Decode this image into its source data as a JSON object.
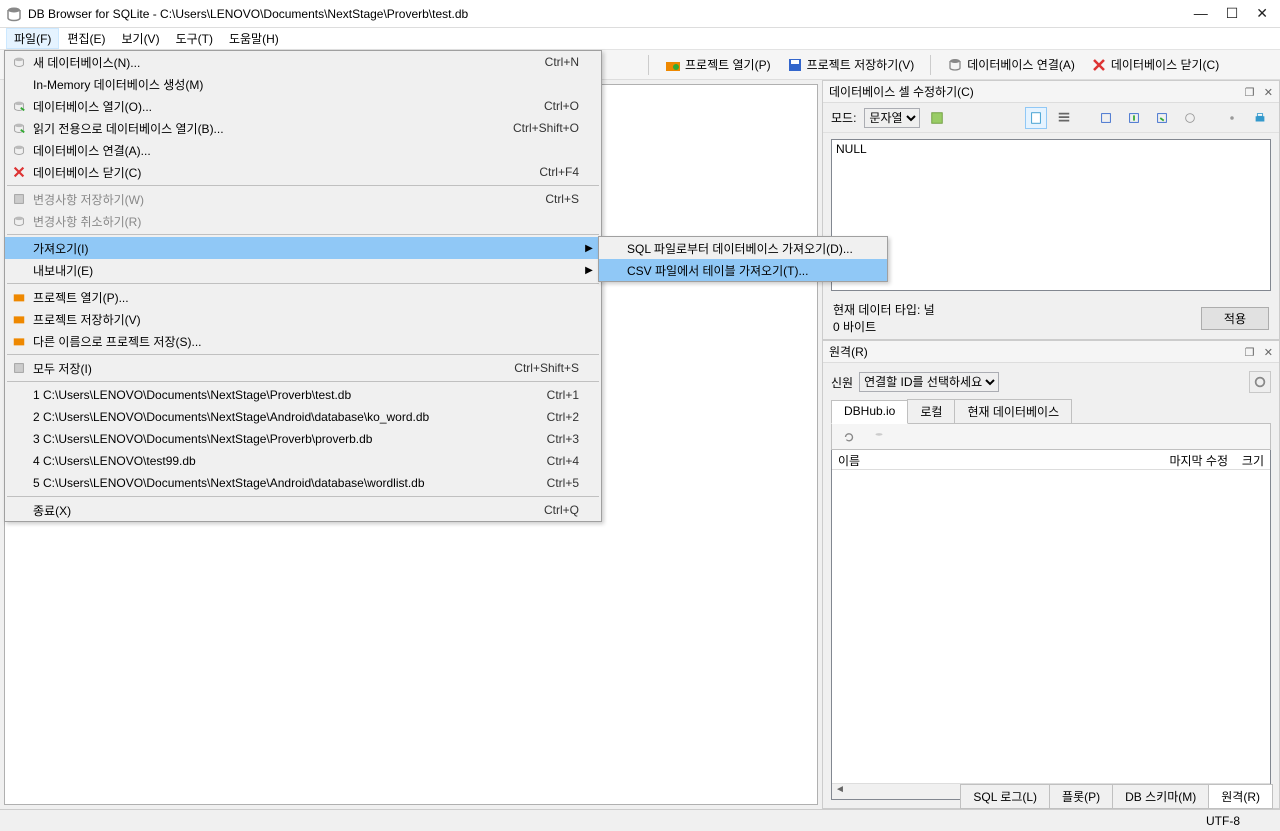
{
  "titlebar": {
    "app": "DB Browser for SQLite",
    "path": "C:\\Users\\LENOVO\\Documents\\NextStage\\Proverb\\test.db"
  },
  "menubar": [
    "파일(F)",
    "편집(E)",
    "보기(V)",
    "도구(T)",
    "도움말(H)"
  ],
  "toolbar": {
    "open_project": "프로젝트 열기(P)",
    "save_project": "프로젝트 저장하기(V)",
    "attach_db": "데이터베이스 연결(A)",
    "close_db": "데이터베이스 닫기(C)"
  },
  "file_menu": [
    {
      "label": "새 데이터베이스(N)...",
      "shortcut": "Ctrl+N",
      "icon": "new-db"
    },
    {
      "label": "In-Memory 데이터베이스 생성(M)",
      "shortcut": "",
      "icon": ""
    },
    {
      "label": "데이터베이스 열기(O)...",
      "shortcut": "Ctrl+O",
      "icon": "open-db"
    },
    {
      "label": "읽기 전용으로 데이터베이스 열기(B)...",
      "shortcut": "Ctrl+Shift+O",
      "icon": "open-db-ro"
    },
    {
      "label": "데이터베이스 연결(A)...",
      "shortcut": "",
      "icon": "attach"
    },
    {
      "label": "데이터베이스 닫기(C)",
      "shortcut": "Ctrl+F4",
      "icon": "close-db"
    },
    {
      "sep": true
    },
    {
      "label": "변경사항 저장하기(W)",
      "shortcut": "Ctrl+S",
      "icon": "save",
      "disabled": true
    },
    {
      "label": "변경사항 취소하기(R)",
      "shortcut": "",
      "icon": "revert",
      "disabled": true
    },
    {
      "sep": true
    },
    {
      "label": "가져오기(I)",
      "shortcut": "",
      "icon": "",
      "arrow": true,
      "highlight": true
    },
    {
      "label": "내보내기(E)",
      "shortcut": "",
      "icon": "",
      "arrow": true
    },
    {
      "sep": true
    },
    {
      "label": "프로젝트 열기(P)...",
      "shortcut": "",
      "icon": "proj-open"
    },
    {
      "label": "프로젝트 저장하기(V)",
      "shortcut": "",
      "icon": "proj-save"
    },
    {
      "label": "다른 이름으로 프로젝트 저장(S)...",
      "shortcut": "",
      "icon": "proj-saveas"
    },
    {
      "sep": true
    },
    {
      "label": "모두 저장(I)",
      "shortcut": "Ctrl+Shift+S",
      "icon": "save-all"
    },
    {
      "sep": true
    },
    {
      "label": "1 C:\\Users\\LENOVO\\Documents\\NextStage\\Proverb\\test.db",
      "shortcut": "Ctrl+1"
    },
    {
      "label": "2 C:\\Users\\LENOVO\\Documents\\NextStage\\Android\\database\\ko_word.db",
      "shortcut": "Ctrl+2"
    },
    {
      "label": "3 C:\\Users\\LENOVO\\Documents\\NextStage\\Proverb\\proverb.db",
      "shortcut": "Ctrl+3"
    },
    {
      "label": "4 C:\\Users\\LENOVO\\test99.db",
      "shortcut": "Ctrl+4"
    },
    {
      "label": "5 C:\\Users\\LENOVO\\Documents\\NextStage\\Android\\database\\wordlist.db",
      "shortcut": "Ctrl+5"
    },
    {
      "sep": true
    },
    {
      "label": "종료(X)",
      "shortcut": "Ctrl+Q"
    }
  ],
  "import_submenu": [
    {
      "label": "SQL 파일로부터 데이터베이스 가져오기(D)..."
    },
    {
      "label": "CSV 파일에서 테이블 가져오기(T)...",
      "highlight": true
    }
  ],
  "cell_panel": {
    "title": "데이터베이스 셀 수정하기(C)",
    "mode_label": "모드:",
    "mode_value": "문자열",
    "textarea": "NULL",
    "type_line": "현재 데이터 타입: 널",
    "size_line": "0 바이트",
    "apply": "적용"
  },
  "remote_panel": {
    "title": "원격(R)",
    "id_label": "신원",
    "id_placeholder": "연결할 ID를 선택하세요",
    "tabs": [
      "DBHub.io",
      "로컬",
      "현재 데이터베이스"
    ],
    "columns": {
      "name": "이름",
      "modified": "마지막 수정",
      "size": "크기"
    }
  },
  "bottom_tabs": [
    "SQL 로그(L)",
    "플롯(P)",
    "DB 스키마(M)",
    "원격(R)"
  ],
  "statusbar": {
    "encoding": "UTF-8"
  }
}
